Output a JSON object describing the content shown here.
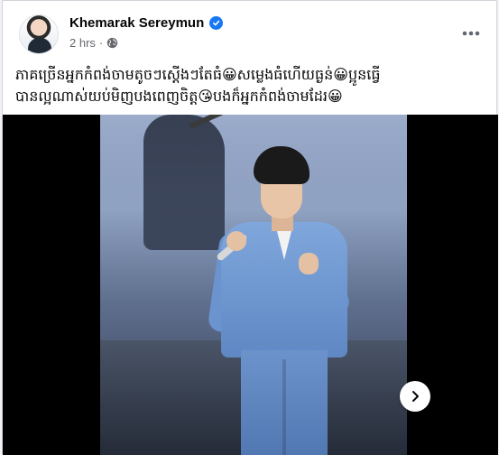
{
  "post": {
    "author": "Khemarak Sereymun",
    "timestamp": "2 hrs",
    "separator": "·",
    "verified": true,
    "audience_icon": "globe-icon",
    "text_line1": "ភាគច្រើនអ្នកកំពង់ចាមតូចៗស្តើងៗតែធំ😀សម្លេងធំហើយធ្ងន់😀ប្អូនធ្វើ",
    "text_line2": "បានល្អណាស់យប់មិញបងពេញចិត្ត😘បងក៏អ្នកកំពង់ចាមដែរ😀"
  },
  "colors": {
    "accent": "#1877f2",
    "secondary_text": "#65676b",
    "video_bg": "#000000"
  },
  "icons": {
    "more": "more-options-icon",
    "next": "chevron-right-icon"
  }
}
